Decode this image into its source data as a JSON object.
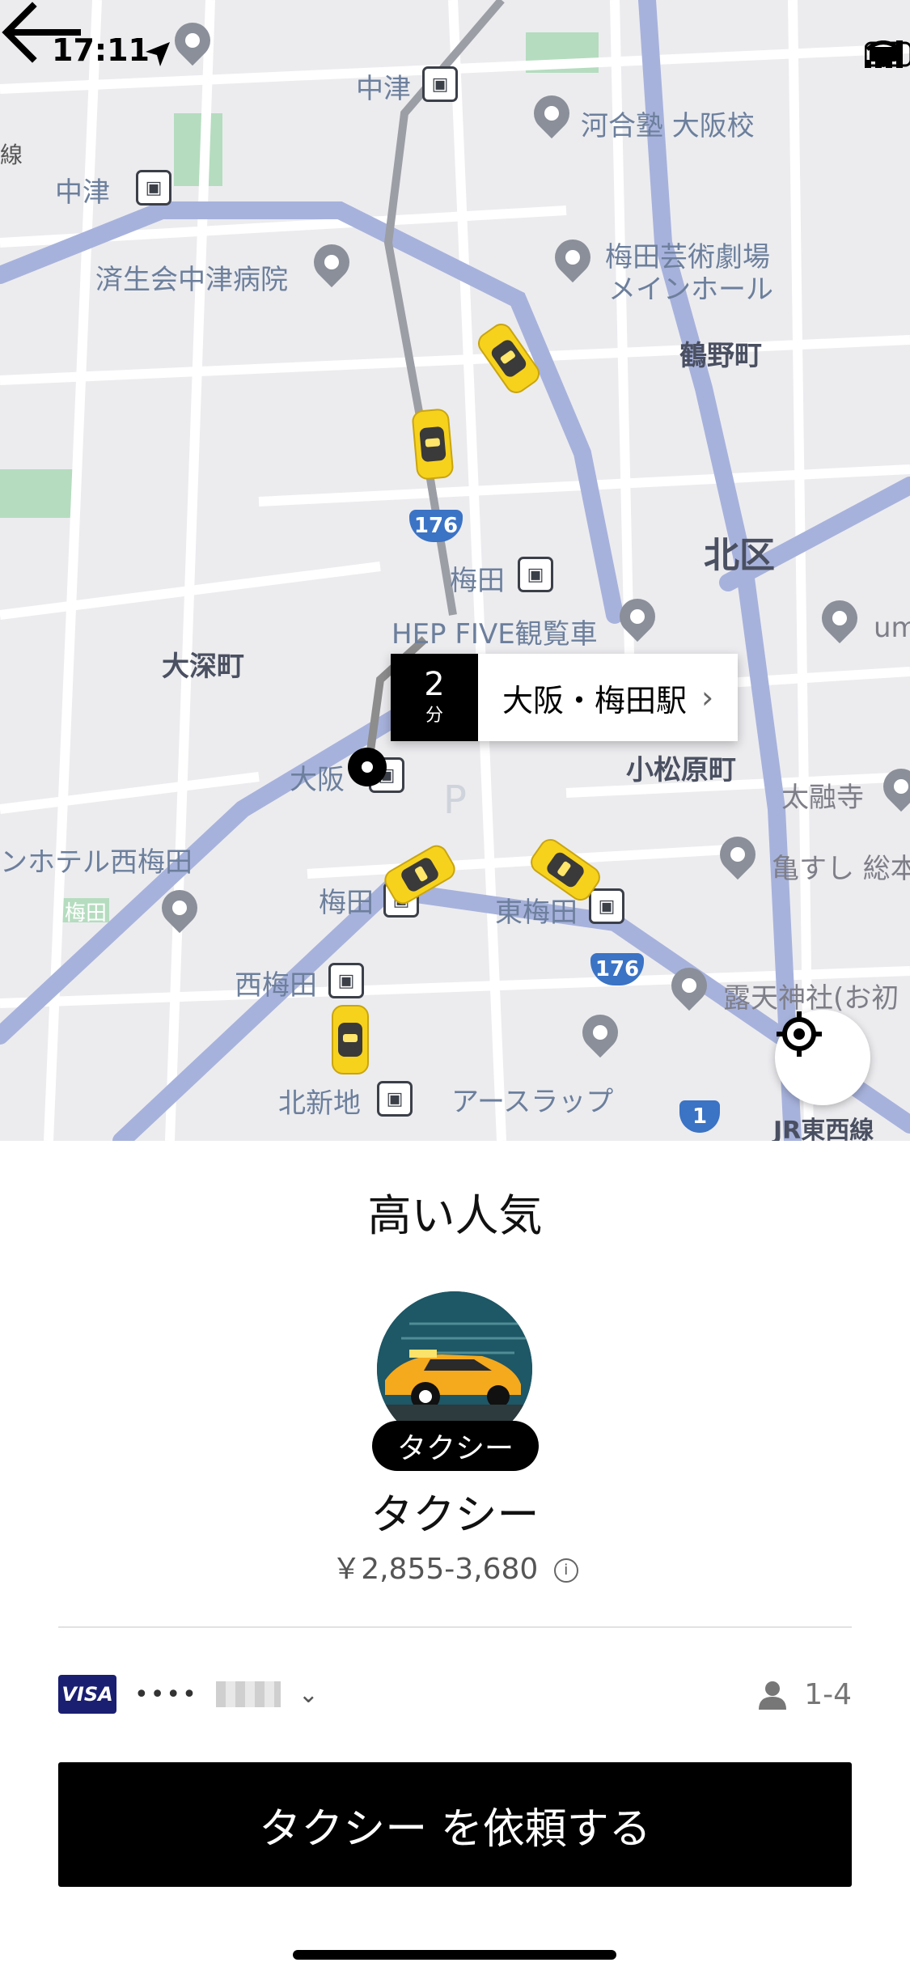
{
  "status_bar": {
    "time": "17:11"
  },
  "map": {
    "eta_minutes": "2",
    "eta_unit": "分",
    "destination": "大阪・梅田駅",
    "labels": [
      "中津",
      "河合塾 大阪校",
      "中津",
      "済生会中津病院",
      "梅田芸術劇場",
      "メインホール",
      "鶴野町",
      "北区",
      "梅田",
      "HEP FIVE観覧車",
      "大深町",
      "大阪",
      "小松原町",
      "太融寺",
      "ンホテル西梅田",
      "梅田",
      "梅田",
      "東梅田",
      "亀すし 総本",
      "西梅田",
      "露天神社(お初",
      "北新地",
      "アースラップ",
      "JR東西線",
      "um",
      "線"
    ],
    "route_shields": [
      "176",
      "176",
      "1"
    ]
  },
  "sheet": {
    "section_title": "高い人気",
    "vehicle_badge": "タクシー",
    "vehicle_name": "タクシー",
    "price": "￥2,855-3,680",
    "payment": {
      "brand": "VISA",
      "masked": "••••"
    },
    "seats": "1-4",
    "request_button": "タクシー を依頼する"
  }
}
